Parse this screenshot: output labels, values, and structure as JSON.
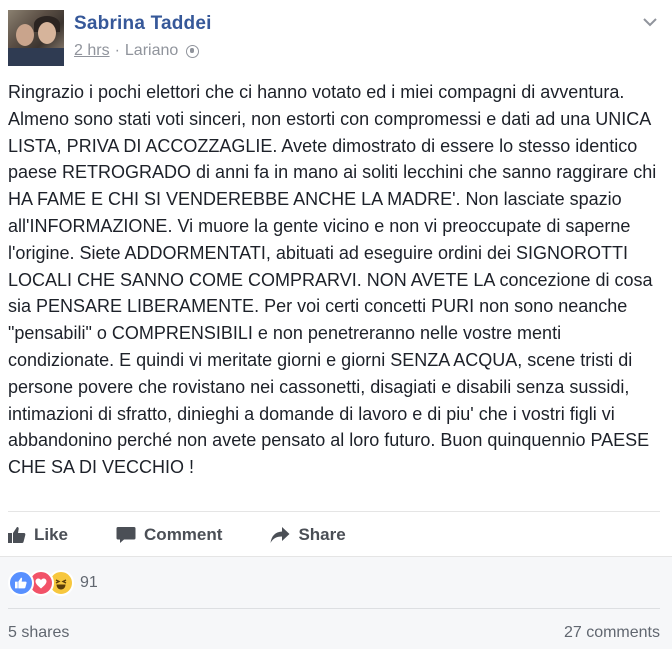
{
  "post": {
    "author": "Sabrina Taddei",
    "time": "2 hrs",
    "separator": "·",
    "location": "Lariano",
    "privacy_icon": "globe-icon",
    "menu_icon": "chevron-down-icon",
    "text": "Ringrazio i pochi elettori che ci hanno votato ed i miei compagni di avventura. Almeno sono stati voti sinceri, non estorti con compromessi e dati ad una UNICA LISTA, PRIVA DI ACCOZZAGLIE. Avete dimostrato di essere lo stesso identico paese RETROGRADO di anni fa in mano ai soliti lecchini che sanno raggirare chi HA FAME E CHI SI VENDEREBBE ANCHE LA MADRE'. Non lasciate spazio all'INFORMAZIONE. Vi muore la gente vicino e non vi preoccupate di saperne l'origine. Siete ADDORMENTATI, abituati ad eseguire ordini dei SIGNOROTTI LOCALI CHE SANNO COME COMPRARVI. NON AVETE LA concezione di cosa sia PENSARE LIBERAMENTE. Per voi certi concetti PURI non sono neanche \"pensabili\" o COMPRENSIBILI e non penetreranno nelle vostre menti condizionate. E quindi vi meritate giorni e giorni SENZA ACQUA, scene tristi di persone povere che rovistano nei cassonetti, disagiati e disabili senza sussidi, intimazioni di sfratto, dinieghi a domande di lavoro e di piu' che i vostri figli vi abbandonino perché non avete pensato al loro futuro. Buon quinquennio PAESE CHE SA DI VECCHIO !"
  },
  "actions": {
    "like": "Like",
    "comment": "Comment",
    "share": "Share"
  },
  "reactions": {
    "icons": [
      "like-reaction-icon",
      "love-reaction-icon",
      "haha-reaction-icon"
    ],
    "count": "91"
  },
  "stats": {
    "shares": "5 shares",
    "comments": "27 comments"
  },
  "colors": {
    "author_link": "#365899",
    "meta": "#90949c",
    "action_text": "#4b4f56",
    "like_blue": "#5890ff",
    "love_red": "#f25268",
    "haha_yellow": "#f7c73e"
  }
}
